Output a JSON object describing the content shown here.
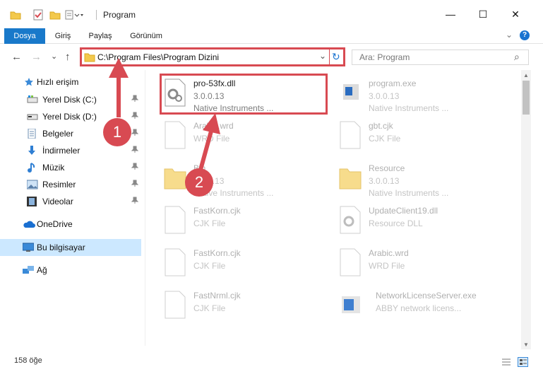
{
  "window": {
    "title": "Program",
    "minimize_glyph": "—",
    "maximize_glyph": "☐",
    "close_glyph": "✕"
  },
  "ribbon": {
    "tabs": [
      {
        "label": "Dosya"
      },
      {
        "label": "Giriş"
      },
      {
        "label": "Paylaş"
      },
      {
        "label": "Görünüm"
      }
    ],
    "help_glyph": "?",
    "collapse_glyph": "⌄"
  },
  "nav": {
    "back_glyph": "←",
    "forward_glyph": "→",
    "recent_glyph": "⌄",
    "up_glyph": "↑",
    "address": "C:\\Program Files\\Program Dizini",
    "refresh_glyph": "↻",
    "dropdown_glyph": "⌄",
    "search_placeholder": "Ara: Program",
    "search_glyph": "⌕"
  },
  "sidebar": {
    "items": [
      {
        "label": "Hızlı erişim",
        "icon": "star-icon"
      },
      {
        "label": "Yerel Disk (C:)",
        "icon": "disk-icon"
      },
      {
        "label": "Yerel Disk (D:)",
        "icon": "disk-icon"
      },
      {
        "label": "Belgeler",
        "icon": "documents-icon"
      },
      {
        "label": "İndirmeler",
        "icon": "download-icon"
      },
      {
        "label": "Müzik",
        "icon": "music-icon"
      },
      {
        "label": "Resimler",
        "icon": "pictures-icon"
      },
      {
        "label": "Videolar",
        "icon": "videos-icon"
      },
      {
        "label": "OneDrive",
        "icon": "cloud-icon"
      },
      {
        "label": "Bu bilgisayar",
        "icon": "computer-icon"
      },
      {
        "label": "Ağ",
        "icon": "network-icon"
      }
    ],
    "pin_glyph": "📌"
  },
  "files": [
    {
      "name": "pro-53fx.dll",
      "line1": "3.0.0.13",
      "line2": "Native Instruments ..."
    },
    {
      "name": "program.exe",
      "line1": "3.0.0.13",
      "line2": "Native Instruments ..."
    },
    {
      "name": "Arabic.wrd",
      "line1": "WRD File",
      "line2": ""
    },
    {
      "name": "gbt.cjk",
      "line1": "CJK File",
      "line2": ""
    },
    {
      "name": "Bin",
      "line1": "3.0.0.13",
      "line2": "Native Instruments ..."
    },
    {
      "name": "Resource",
      "line1": "3.0.0.13",
      "line2": "Native Instruments ..."
    },
    {
      "name": "FastKorn.cjk",
      "line1": "CJK File",
      "line2": ""
    },
    {
      "name": "UpdateClient19.dll",
      "line1": "Resource DLL",
      "line2": ""
    },
    {
      "name": "FastKorn.cjk",
      "line1": "CJK File",
      "line2": ""
    },
    {
      "name": "Arabic.wrd",
      "line1": "WRD File",
      "line2": ""
    },
    {
      "name": "FastNrml.cjk",
      "line1": "CJK File",
      "line2": ""
    },
    {
      "name": "NetworkLicenseServer.exe",
      "line1": "ABBY network licens...",
      "line2": ""
    }
  ],
  "status": {
    "item_count": "158 öğe"
  },
  "callouts": {
    "one": "1",
    "two": "2"
  },
  "colors": {
    "accent": "#1979ca",
    "highlight": "#d84a52",
    "selection": "#cce8ff"
  }
}
